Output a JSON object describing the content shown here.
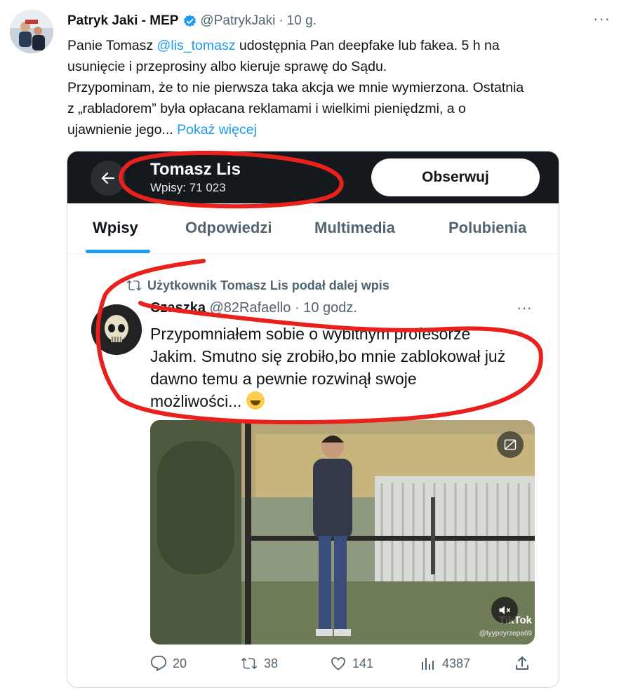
{
  "post": {
    "author_name": "Patryk Jaki - MEP",
    "handle": "@PatrykJaki",
    "separator": "·",
    "time": "10 g.",
    "more_label": "···",
    "text_line1_a": "Panie Tomasz ",
    "mention": "@lis_tomasz",
    "text_line1_b": " udostępnia Pan deepfake lub fakea. 5 h na",
    "text_line2": "usunięcie i przeprosiny albo kieruje sprawę do Sądu.",
    "text_line3": "Przypominam, że to nie pierwsza taka akcja we mnie wymierzona. Ostatnia",
    "text_line4": "z „rabladorem” była opłacana reklamami i wielkimi pieniędzmi, a o",
    "text_line5": "ujawnienie jego... ",
    "show_more": "Pokaż więcej"
  },
  "embedded": {
    "profile_name": "Tomasz Lis",
    "profile_count": "Wpisy: 71 023",
    "follow_label": "Obserwuj",
    "tabs": [
      {
        "label": "Wpisy",
        "active": true
      },
      {
        "label": "Odpowiedzi",
        "active": false
      },
      {
        "label": "Multimedia",
        "active": false
      },
      {
        "label": "Polubienia",
        "active": false
      }
    ],
    "repost_label": "Użytkownik Tomasz Lis podał dalej wpis",
    "inner_name": "Czaszka",
    "inner_handle": "@82Rafaello",
    "inner_separator": "·",
    "inner_time": "10 godz.",
    "inner_more": "···",
    "inner_text_1": "Przypomniałem sobie o wybitnym profesorze",
    "inner_text_2": "Jakim. Smutno się zrobiło,bo mnie zablokował już",
    "inner_text_3": "dawno temu a pewnie rozwinął swoje",
    "inner_text_4": "możliwości...",
    "video_watermark": "TikTok",
    "video_handle": "@tyypoyrzepa69",
    "actions": {
      "replies": "20",
      "reposts": "38",
      "likes": "141",
      "views": "4387"
    }
  },
  "colors": {
    "link": "#1d9bf0",
    "annotation": "#e8211c",
    "dark_header": "#15181c",
    "muted": "#536471"
  },
  "icons": [
    "verified-badge-icon",
    "back-arrow-icon",
    "repost-icon",
    "reply-icon",
    "like-icon",
    "views-icon",
    "share-icon",
    "sensitive-media-icon",
    "mute-icon",
    "tiktok-icon"
  ]
}
